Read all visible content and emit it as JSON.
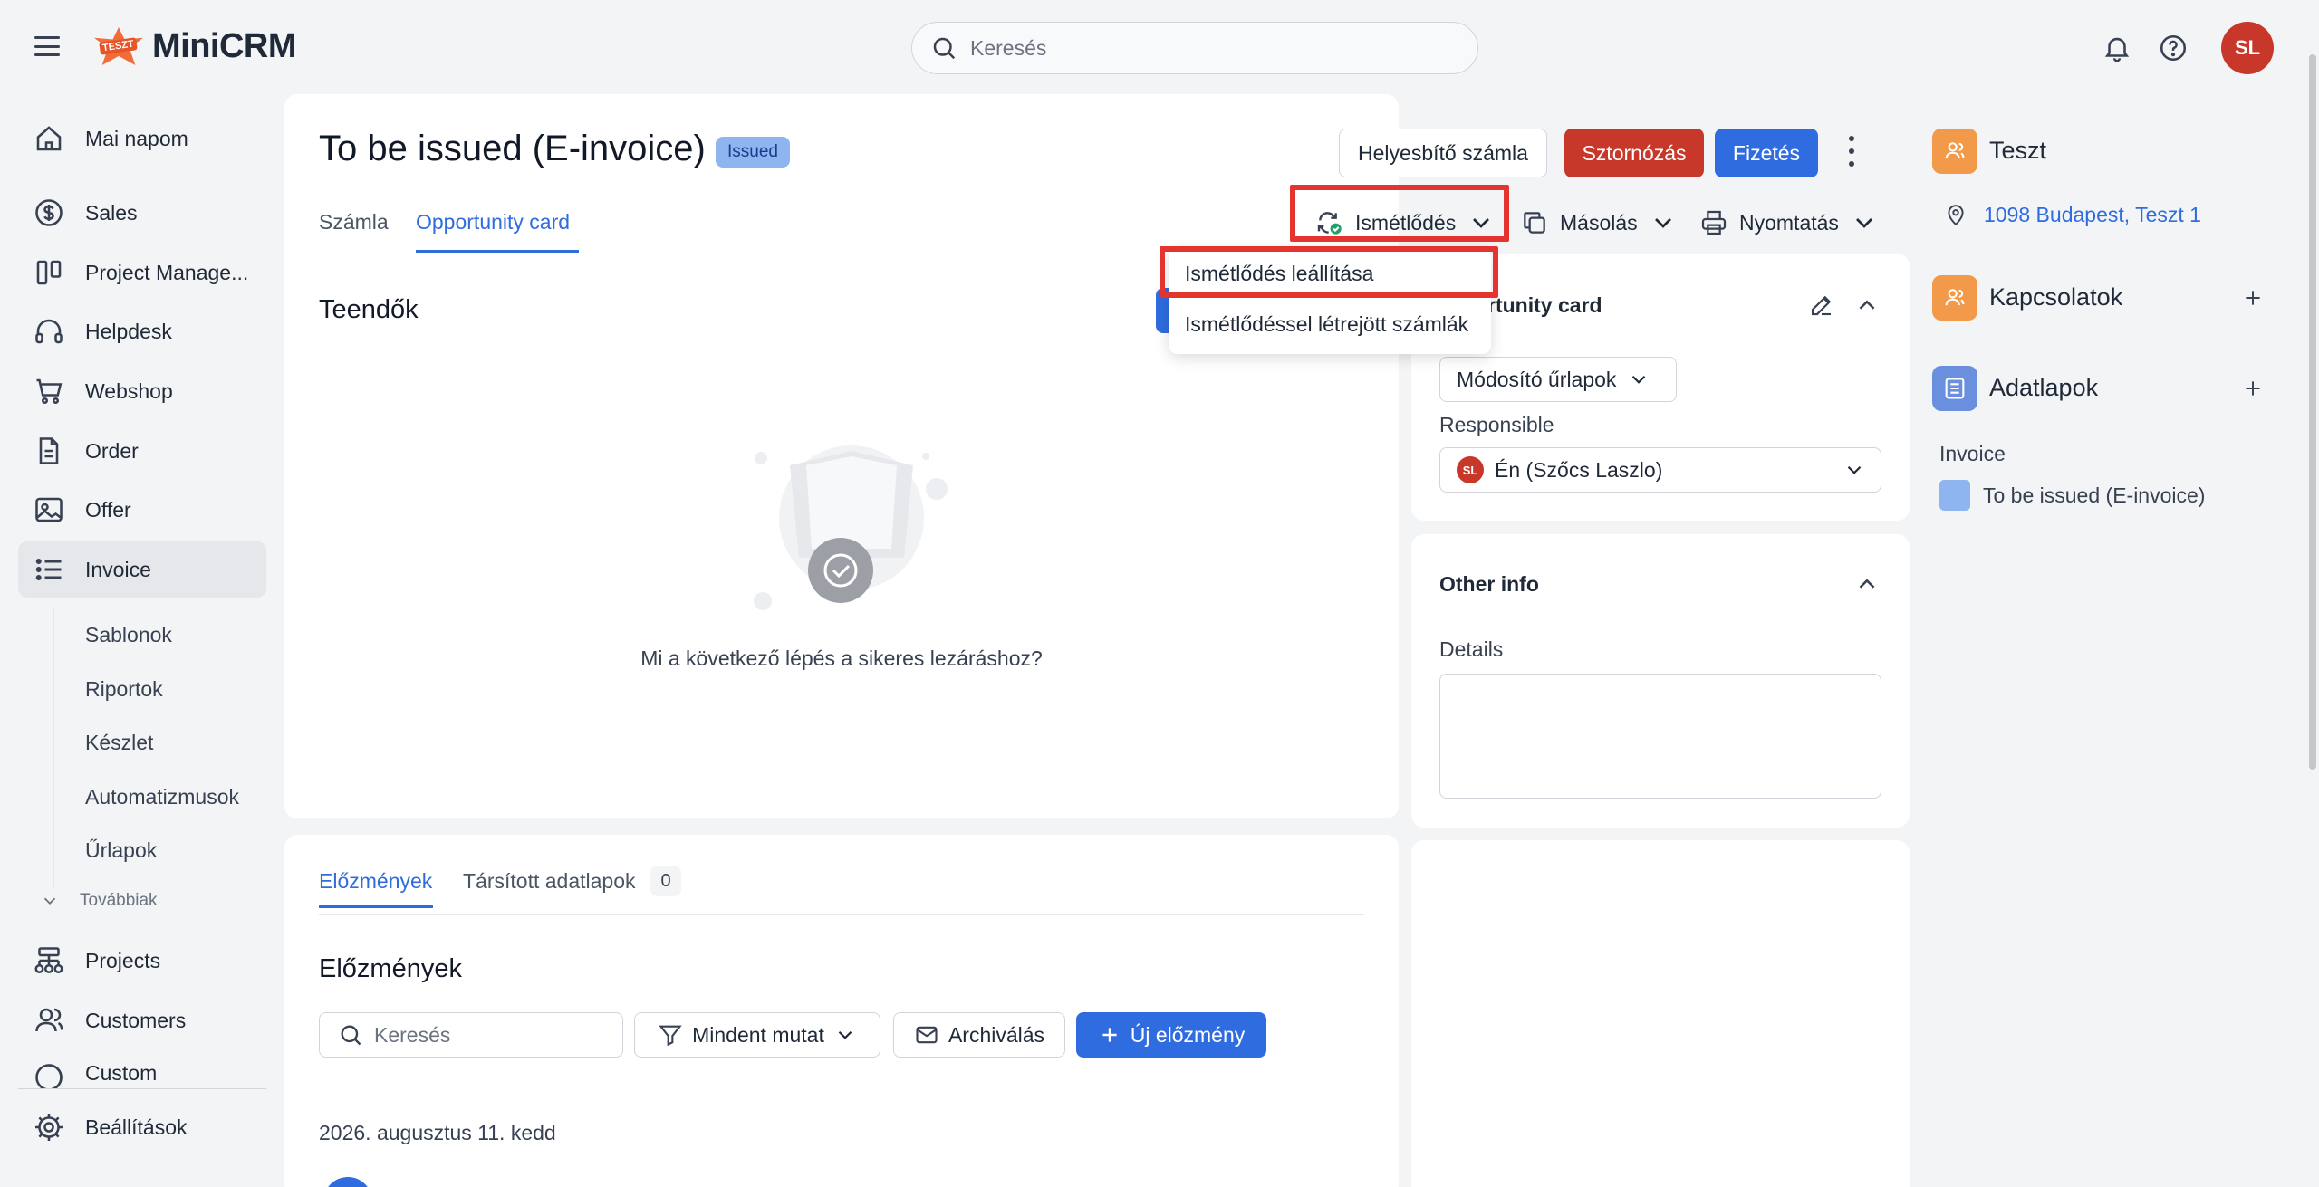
{
  "app": {
    "name": "MiniCRM",
    "logo_tag": "TESZT"
  },
  "topbar": {
    "search_placeholder": "Keresés",
    "avatar_initials": "SL",
    "icons": [
      "bell-icon",
      "help-icon"
    ]
  },
  "sidebar": {
    "items": [
      {
        "label": "Mai napom",
        "icon": "home-icon"
      },
      {
        "label": "Sales",
        "icon": "dollar-icon"
      },
      {
        "label": "Project Manage...",
        "icon": "columns-icon"
      },
      {
        "label": "Helpdesk",
        "icon": "headset-icon"
      },
      {
        "label": "Webshop",
        "icon": "cart-icon"
      },
      {
        "label": "Order",
        "icon": "document-icon"
      },
      {
        "label": "Offer",
        "icon": "image-icon"
      },
      {
        "label": "Invoice",
        "icon": "list-icon",
        "active": true
      }
    ],
    "sub_items": [
      "Sablonok",
      "Riportok",
      "Készlet",
      "Automatizmusok",
      "Űrlapok"
    ],
    "more_label": "Továbbiak",
    "lower_items": [
      {
        "label": "Projects",
        "icon": "sitemap-icon"
      },
      {
        "label": "Customers",
        "icon": "users-icon"
      },
      {
        "label": "Custom",
        "icon": "circle-icon"
      }
    ],
    "settings_label": "Beállítások"
  },
  "header": {
    "title": "To be issued (E-invoice)",
    "status_badge": "Issued",
    "buttons": {
      "correction": "Helyesbítő számla",
      "cancel": "Sztornózás",
      "payment": "Fizetés"
    },
    "tabs": [
      {
        "label": "Számla"
      },
      {
        "label": "Opportunity card",
        "active": true
      }
    ],
    "toolbar": {
      "recurrence": "Ismétlődés",
      "copy": "Másolás",
      "print": "Nyomtatás"
    }
  },
  "dropdown": {
    "items": [
      "Ismétlődés leállítása",
      "Ismétlődéssel létrejött számlák"
    ]
  },
  "todos": {
    "title": "Teendők",
    "empty_text": "Mi a következő lépés a sikeres lezáráshoz?"
  },
  "opportunity_panel": {
    "title": "Opportunity card",
    "title_visible": "rtunity card",
    "modifier_forms": "Módosító űrlapok",
    "responsible_label": "Responsible",
    "responsible_value": "Én (Szőcs Laszlo)",
    "responsible_initials": "SL"
  },
  "other_info": {
    "title": "Other info",
    "details_label": "Details",
    "details_value": ""
  },
  "history": {
    "tabs": [
      {
        "label": "Előzmények",
        "active": true
      },
      {
        "label": "Társított adatlapok",
        "count": "0"
      }
    ],
    "title": "Előzmények",
    "search_placeholder": "Keresés",
    "filter_label": "Mindent mutat",
    "archive_label": "Archiválás",
    "new_label": "Új előzmény",
    "date": "2026. augusztus 11. kedd"
  },
  "right_panel": {
    "company": "Teszt",
    "address": "1098 Budapest, Teszt 1",
    "contacts": "Kapcsolatok",
    "datasheets": "Adatlapok",
    "invoice_label": "Invoice",
    "invoice_item": "To be issued (E-invoice)"
  },
  "colors": {
    "accent_blue": "#2f6ce0",
    "danger_red": "#c8382a",
    "highlight_red": "#e3342f",
    "badge_blue": "#8fb5f0",
    "orange": "#f29a4a"
  }
}
